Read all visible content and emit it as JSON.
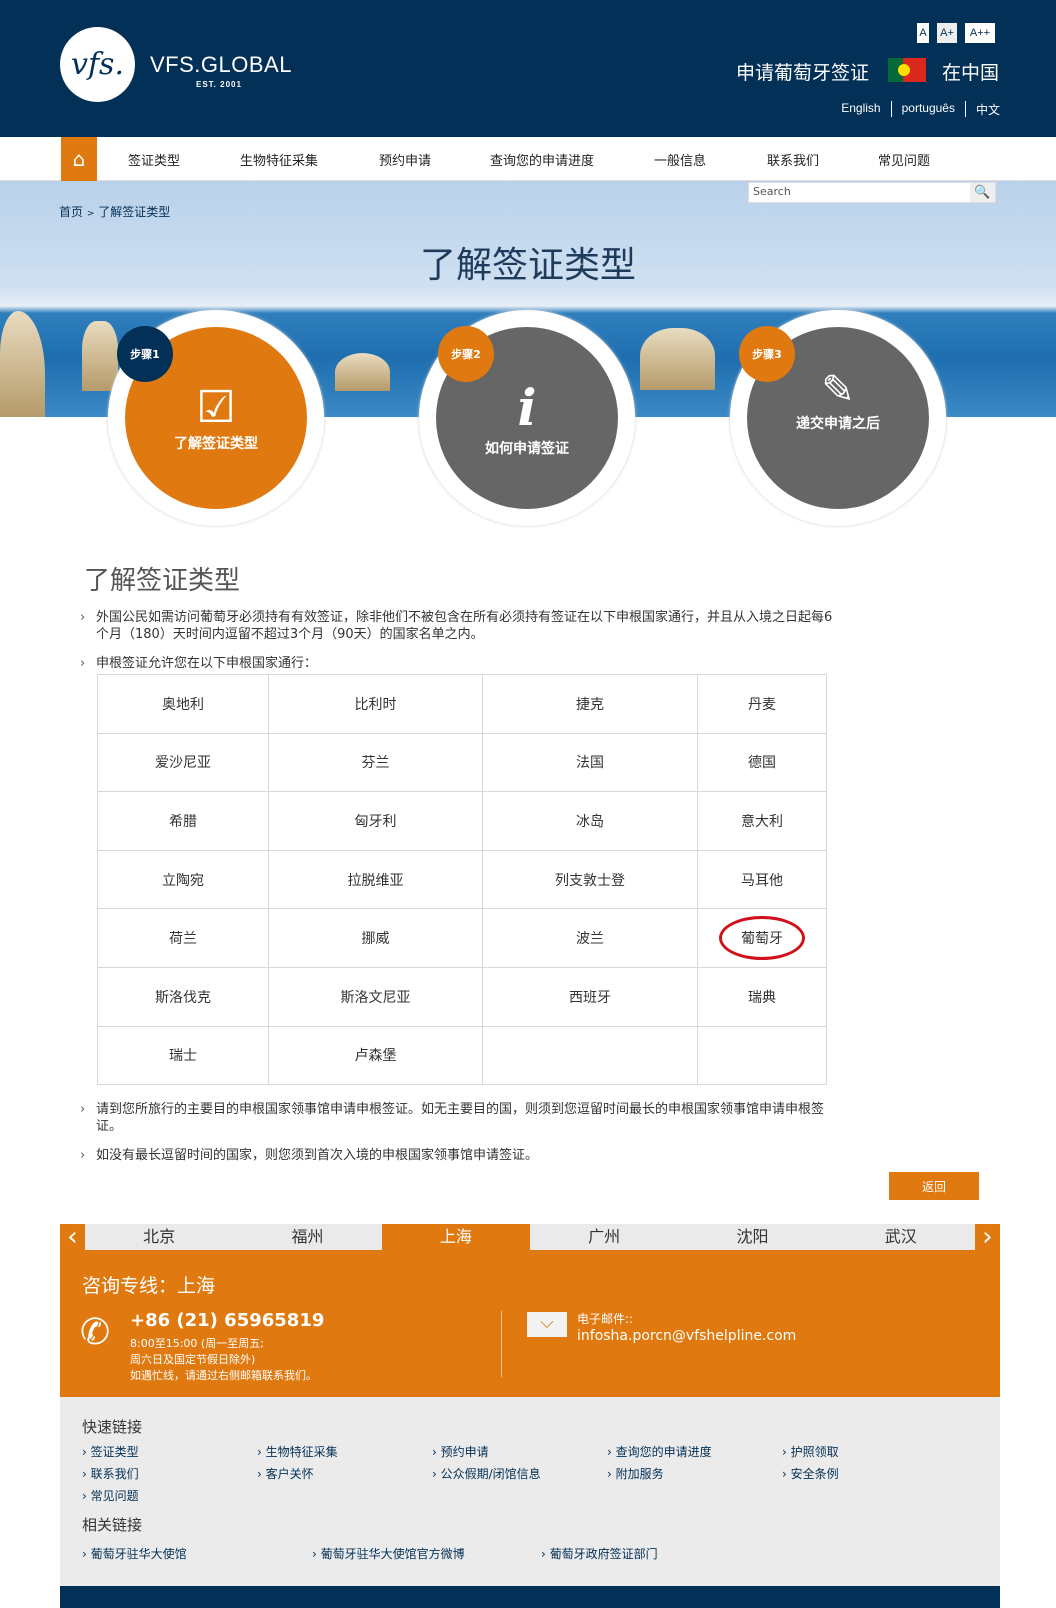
{
  "header": {
    "logo_text": "vfs.",
    "brand": "VFS.GLOBAL",
    "est": "EST. 2001",
    "font_sizes": [
      "A",
      "A+",
      "A++"
    ],
    "title": "申请葡萄牙签证",
    "country": "在中国",
    "languages": [
      "English",
      "português",
      "中文"
    ]
  },
  "nav": {
    "items": [
      "签证类型",
      "生物特征采集",
      "预约申请",
      "查询您的申请进度",
      "一般信息",
      "联系我们",
      "常见问题"
    ]
  },
  "search": {
    "placeholder": "Search"
  },
  "breadcrumb": {
    "home": "首页",
    "sep": ">",
    "current": "了解签证类型"
  },
  "hero": {
    "title": "了解签证类型"
  },
  "steps": [
    {
      "badge": "步骤1",
      "label": "了解签证类型",
      "icon": "checkbox-icon",
      "active": true
    },
    {
      "badge": "步骤2",
      "label": "如何申请签证",
      "icon": "info-icon",
      "active": false
    },
    {
      "badge": "步骤3",
      "label": "递交申请之后",
      "icon": "pencil-icon",
      "active": false
    }
  ],
  "content": {
    "heading": "了解签证类型",
    "bullets": [
      "外国公民如需访问葡萄牙必须持有有效签证，除非他们不被包含在所有必须持有签证在以下申根国家通行，并且从入境之日起每6个月（180）天时间内逗留不超过3个月（90天）的国家名单之内。",
      "申根签证允许您在以下申根国家通行："
    ],
    "table": [
      [
        "奥地利",
        "比利时",
        "捷克",
        "丹麦"
      ],
      [
        "爱沙尼亚",
        "芬兰",
        "法国",
        "德国"
      ],
      [
        "希腊",
        "匈牙利",
        "冰岛",
        "意大利"
      ],
      [
        "立陶宛",
        "拉脱维亚",
        "列支敦士登",
        "马耳他"
      ],
      [
        "荷兰",
        "挪威",
        "波兰",
        "葡萄牙"
      ],
      [
        "斯洛伐克",
        "斯洛文尼亚",
        "西班牙",
        "瑞典"
      ],
      [
        "瑞士",
        "卢森堡",
        "",
        ""
      ]
    ],
    "bullets_after": [
      "请到您所旅行的主要目的申根国家领事馆申请申根签证。如无主要目的国，则须到您逗留时间最长的申根国家领事馆申请申根签证。",
      "如没有最长逗留时间的国家，则您须到首次入境的申根国家领事馆申请签证。"
    ],
    "back": "返回"
  },
  "cities": {
    "tabs": [
      "北京",
      "福州",
      "上海",
      "广州",
      "沈阳",
      "武汉"
    ],
    "active": "上海"
  },
  "contact": {
    "title": "咨询专线：上海",
    "phone": "+86 (21) 65965819",
    "hours1": "8:00至15:00 (周一至周五;",
    "hours2": "周六日及国定节假日除外)",
    "hours3": "如遇忙线，请通过右侧邮箱联系我们。",
    "email_label": "电子邮件::",
    "email": "infosha.porcn@vfshelpline.com"
  },
  "footer": {
    "quick_title": "快速链接",
    "quick_links": [
      "签证类型",
      "生物特征采集",
      "预约申请",
      "查询您的申请进度",
      "护照领取",
      "联系我们",
      "客户关怀",
      "公众假期/闭馆信息",
      "附加服务",
      "安全条例",
      "常见问题"
    ],
    "related_title": "相关链接",
    "related_links": [
      "葡萄牙驻华大使馆",
      "葡萄牙驻华大使馆官方微博",
      "葡萄牙政府签证部门"
    ]
  },
  "colors": {
    "navy": "#033056",
    "orange": "#e07a10",
    "gray": "#666666"
  }
}
